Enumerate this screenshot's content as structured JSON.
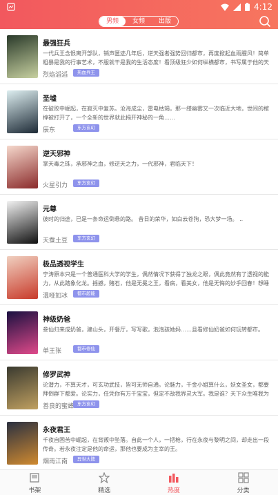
{
  "status": {
    "time": "4:12"
  },
  "header": {
    "tabs": [
      "男频",
      "女频",
      "出版"
    ],
    "active_tab": 0
  },
  "books": [
    {
      "title": "最强狂兵",
      "desc": "一代兵王含恨离开部队，销声匿迹几年后，逆天强者强势回归都市，再度掀起血雨腥风！简单粗暴是我的行事艺术，不服就干是我的生活态度！看顶级狂少如何纵横都市，书写属于他的天王传奇！依旧极爽极热血！",
      "author": "烈焰滔滔",
      "tag": "热血兵王",
      "cover": [
        "#2a3a2a",
        "#c7d0a0"
      ]
    },
    {
      "title": "圣墟",
      "desc": "在破败中崛起，在寂灭中复苏。沧海成尘，雷电枯竭，那一缕幽雾又一次临近大地，世间的棺椁被打开了，一个全新的世界就此揭开神秘的一角……",
      "author": "辰东",
      "tag": "东方玄幻",
      "cover": [
        "#ddeef0",
        "#1d2a36"
      ]
    },
    {
      "title": "逆天邪神",
      "desc": "掌天毒之珠，承邪神之血，修逆天之力，一代邪神，君临天下！",
      "author": "火星引力",
      "tag": "东方玄幻",
      "cover": [
        "#f5d8cc",
        "#8a2a2a"
      ]
    },
    {
      "title": "元尊",
      "desc": "彼时的归途，已是一条命运倒悬的路。\n昔日的荣华，如白云苍狗，恐大梦一场。 ..",
      "author": "天蚕土豆",
      "tag": "东方玄幻",
      "cover": [
        "#f2f2f2",
        "#111111"
      ]
    },
    {
      "title": "极品透视学生",
      "desc": "宁涛原本只是一个普通医科大学的学生，偶然情况下获得了独龙之眼，偶此竟然有了透视的能力，从此踏象化龙。摇撼，赌石，他是无冕之王，看病，看美女，他是无悔的妙手回春！想睡虚小妹，暴个曾妇，然科一个个……",
      "author": "温哑如冰",
      "tag": "都市超能",
      "cover": [
        "#f0d0c0",
        "#c83a2a"
      ]
    },
    {
      "title": "神级奶爸",
      "desc": "叁仙归来成奶爸，建山头，开餐厅，写写歌，泡泡孩她妈……且看修仙奶爸如何玩转都市。",
      "author": "单王张",
      "tag": "都市修仙",
      "cover": [
        "#1a1040",
        "#e04a8a"
      ]
    },
    {
      "title": "修罗武神",
      "desc": "论潜力，不算天才，可玄功武技，皆可无师自通。论魅力，千金小姐算什么，妖女圣女，都要拜倒群下都爱。论实力，任凭你有万千宝宝，但定不敌我界灵大军。我是谁？天下众生唯我为修罗，却不知，我以修罗成武神。",
      "author": "善良的蜜蜂",
      "tag": "东方玄幻",
      "cover": [
        "#3a3a30",
        "#c0a060"
      ]
    },
    {
      "title": "永夜君王",
      "desc": "千夜自困苦中崛起，在背叛中坠落。自此一个人，一把枪，行在永夜与黎明之间，却走出一段传奇。若永夜注定是他的命运，那他也要成为主宰的王。",
      "author": "烟雨江南",
      "tag": "异世大陆",
      "cover": [
        "#2a3040",
        "#d08a30"
      ]
    }
  ],
  "bottom_nav": [
    {
      "label": "书架",
      "icon": "bookshelf-icon"
    },
    {
      "label": "精选",
      "icon": "star-icon"
    },
    {
      "label": "热度",
      "icon": "hot-bars-icon"
    },
    {
      "label": "分类",
      "icon": "grid-icon"
    }
  ],
  "active_nav": 2,
  "colors": {
    "accent": "#f2585e",
    "tag": "#8e93ec"
  }
}
